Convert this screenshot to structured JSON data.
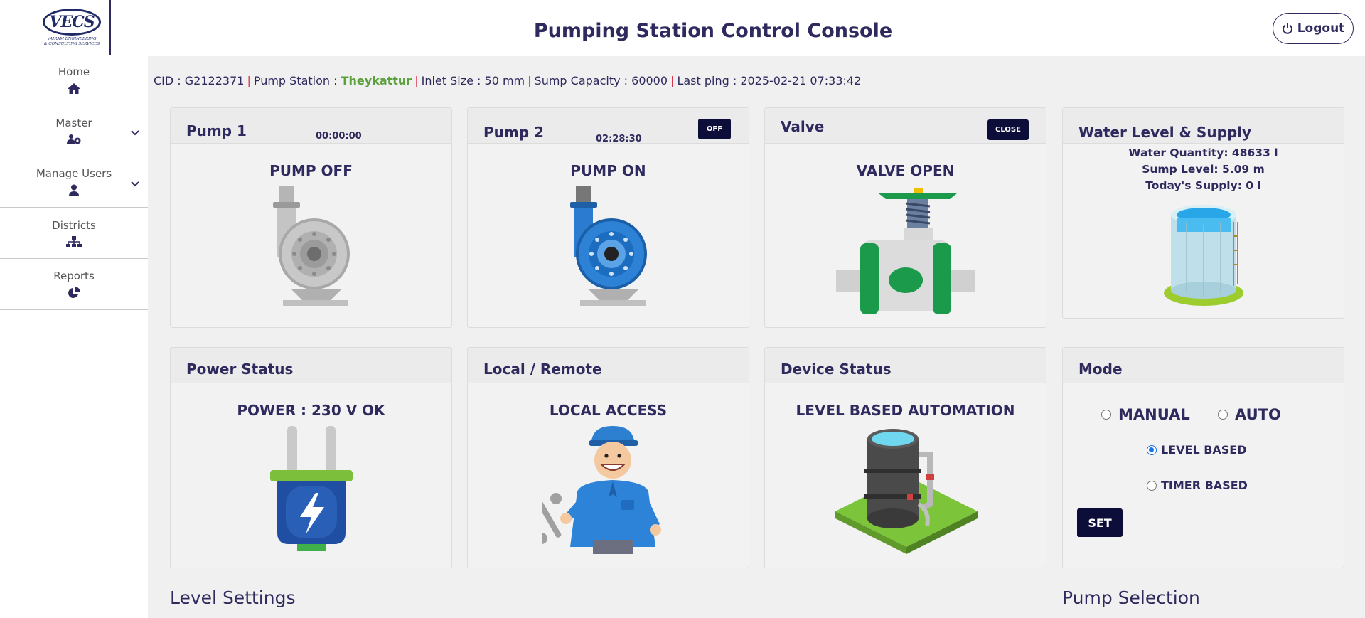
{
  "header": {
    "title": "Pumping Station Control Console",
    "logout_label": "Logout"
  },
  "brand": {
    "logo_text": "VECS",
    "logo_sub1": "VAIRAM ENGINEERING",
    "logo_sub2": "& CONSULTING SERVICES"
  },
  "sidebar": {
    "items": [
      {
        "label": "Home",
        "icon": "home-icon"
      },
      {
        "label": "Master",
        "icon": "users-gear-icon"
      },
      {
        "label": "Manage Users",
        "icon": "user-icon"
      },
      {
        "label": "Districts",
        "icon": "sitemap-icon"
      },
      {
        "label": "Reports",
        "icon": "pie-chart-icon"
      }
    ]
  },
  "info": {
    "cid": "CID : G2122371",
    "pump_station_label": "Pump Station : ",
    "pump_station_value": "Theykattur",
    "inlet": "Inlet Size : 50 mm",
    "sump": "Sump Capacity : 60000",
    "last_ping": "Last ping : 2025-02-21 07:33:42"
  },
  "pump1": {
    "title": "Pump 1",
    "timer": "00:00:00",
    "status": "PUMP OFF"
  },
  "pump2": {
    "title": "Pump 2",
    "timer": "02:28:30",
    "status": "PUMP ON",
    "button": "OFF"
  },
  "valve": {
    "title": "Valve",
    "status": "VALVE OPEN",
    "button": "CLOSE"
  },
  "water": {
    "title": "Water Level & Supply",
    "quantity": "Water Quantity: 48633 l",
    "sump_level": "Sump Level: 5.09 m",
    "supply": "Today's Supply: 0 l"
  },
  "power": {
    "title": "Power Status",
    "status": "POWER : 230 V OK"
  },
  "local": {
    "title": "Local / Remote",
    "status": "LOCAL ACCESS"
  },
  "device": {
    "title": "Device Status",
    "status": "LEVEL BASED AUTOMATION"
  },
  "mode": {
    "title": "Mode",
    "manual": "MANUAL",
    "auto": "AUTO",
    "level_based": "LEVEL BASED",
    "timer_based": "TIMER BASED",
    "set_label": "SET",
    "selected": "LEVEL BASED"
  },
  "sections": {
    "level_settings": "Level Settings",
    "pump_selection": "Pump Selection"
  },
  "colors": {
    "primary": "#2e2a5e",
    "accent_green": "#5aa03c",
    "separator_red": "#d9304a",
    "button_dark": "#0d0d3a"
  }
}
